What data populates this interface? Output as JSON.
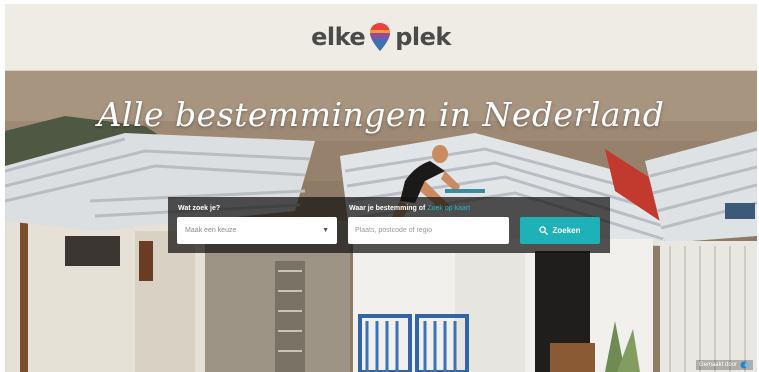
{
  "header": {
    "logo_left": "elke",
    "logo_right": "plek"
  },
  "hero": {
    "tagline": "Alle bestemmingen in Nederland"
  },
  "search": {
    "what_label": "Wat zoek je?",
    "what_selected": "Maak een keuze",
    "where_label": "Waar je bestemming of",
    "where_link": "Zoek op kaart",
    "where_placeholder": "Plaats, postcode of regio",
    "button_label": "Zoeken"
  },
  "credit": {
    "text": "Gemaakt door"
  },
  "colors": {
    "accent": "#1fb1b8",
    "header_bg": "#efece6",
    "logo_text": "#4a4a4a"
  },
  "icons": {
    "logo": "map-pin-icon",
    "search": "search-icon",
    "dropdown": "chevron-down-icon"
  }
}
